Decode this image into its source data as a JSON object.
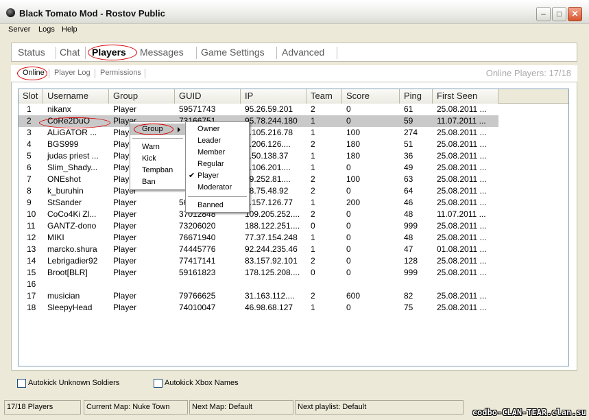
{
  "window": {
    "title": "Black Tomato Mod - Rostov Public",
    "min_label": "–",
    "max_label": "□",
    "close_label": "✕"
  },
  "menu": [
    "Server",
    "Logs",
    "Help"
  ],
  "main_tabs": [
    "Status",
    "Chat",
    "Players",
    "Messages",
    "Game Settings",
    "Advanced"
  ],
  "active_main_tab": "Players",
  "sub_tabs": [
    "Online",
    "Player Log",
    "Permissions"
  ],
  "active_sub_tab": "Online",
  "online_players_label": "Online Players: 17/18",
  "columns": [
    "Slot",
    "Username",
    "Group",
    "GUID",
    "IP",
    "Team",
    "Score",
    "Ping",
    "First Seen"
  ],
  "rows": [
    [
      "1",
      "nikanx",
      "Player",
      "59571743",
      "95.26.59.201",
      "2",
      "0",
      "61",
      "25.08.2011 ..."
    ],
    [
      "2",
      "CoRe2DuO",
      "Player",
      "73166751",
      "95.78.244.180",
      "1",
      "0",
      "59",
      "11.07.2011 ..."
    ],
    [
      "3",
      "ALiGATOR ...",
      "Player",
      "",
      "9.105.216.78",
      "1",
      "100",
      "274",
      "25.08.2011 ..."
    ],
    [
      "4",
      "BGS999",
      "Player",
      "",
      "1.206.126....",
      "2",
      "180",
      "51",
      "25.08.2011 ..."
    ],
    [
      "5",
      "judas priest ...",
      "Player",
      "",
      "4.50.138.37",
      "1",
      "180",
      "36",
      "25.08.2011 ..."
    ],
    [
      "6",
      "Slim_Shady...",
      "Player",
      "",
      "8.106.201....",
      "1",
      "0",
      "49",
      "25.08.2011 ..."
    ],
    [
      "7",
      "ONEshot",
      "Player",
      "",
      "09.252.81....",
      "2",
      "100",
      "63",
      "25.08.2011 ..."
    ],
    [
      "8",
      "k_buruhin",
      "Player",
      "",
      "78.75.48.92",
      "2",
      "0",
      "64",
      "25.08.2011 ..."
    ],
    [
      "9",
      "StSander",
      "Player",
      "56",
      "3.157.126.77",
      "1",
      "200",
      "46",
      "25.08.2011 ..."
    ],
    [
      "10",
      "CoCo4Ki Zl...",
      "Player",
      "37012848",
      "109.205.252....",
      "2",
      "0",
      "48",
      "11.07.2011 ..."
    ],
    [
      "11",
      "GANTZ-dono",
      "Player",
      "73206020",
      "188.122.251....",
      "0",
      "0",
      "999",
      "25.08.2011 ..."
    ],
    [
      "12",
      "MIKI",
      "Player",
      "76671940",
      "77.37.154.248",
      "1",
      "0",
      "48",
      "25.08.2011 ..."
    ],
    [
      "13",
      "marcko.shura",
      "Player",
      "74445776",
      "92.244.235.46",
      "1",
      "0",
      "47",
      "01.08.2011 ..."
    ],
    [
      "14",
      "Lebrigadier92",
      "Player",
      "77417141",
      "83.157.92.101",
      "2",
      "0",
      "128",
      "25.08.2011 ..."
    ],
    [
      "15",
      "Broot[BLR]",
      "Player",
      "59161823",
      "178.125.208....",
      "0",
      "0",
      "999",
      "25.08.2011 ..."
    ],
    [
      "16",
      "",
      "",
      "",
      "",
      "",
      "",
      "",
      ""
    ],
    [
      "17",
      "musician",
      "Player",
      "79766625",
      "31.163.112....",
      "2",
      "600",
      "82",
      "25.08.2011 ..."
    ],
    [
      "18",
      "SleepyHead",
      "Player",
      "74010047",
      "46.98.68.127",
      "1",
      "0",
      "75",
      "25.08.2011 ..."
    ]
  ],
  "selected_row": 2,
  "context_menu": {
    "items": [
      "Group",
      "Warn",
      "Kick",
      "Tempban",
      "Ban"
    ],
    "highlighted": "Group"
  },
  "group_submenu": {
    "items": [
      "Owner",
      "Leader",
      "Member",
      "Regular",
      "Player",
      "Moderator",
      "Banned"
    ],
    "checked": "Player"
  },
  "checkboxes": [
    {
      "label": "Autokick Unknown Soldiers",
      "checked": false
    },
    {
      "label": "Autokick Xbox Names",
      "checked": false
    }
  ],
  "status_bar": [
    "17/18 Players",
    "Current Map: Nuke Town",
    "Next Map: Default",
    "Next playlist: Default"
  ],
  "watermark": "codbo-CLAN-TEAR.clan.su",
  "colors": {
    "annotation_red": "#D80000",
    "selection": "#C9C9C9"
  }
}
